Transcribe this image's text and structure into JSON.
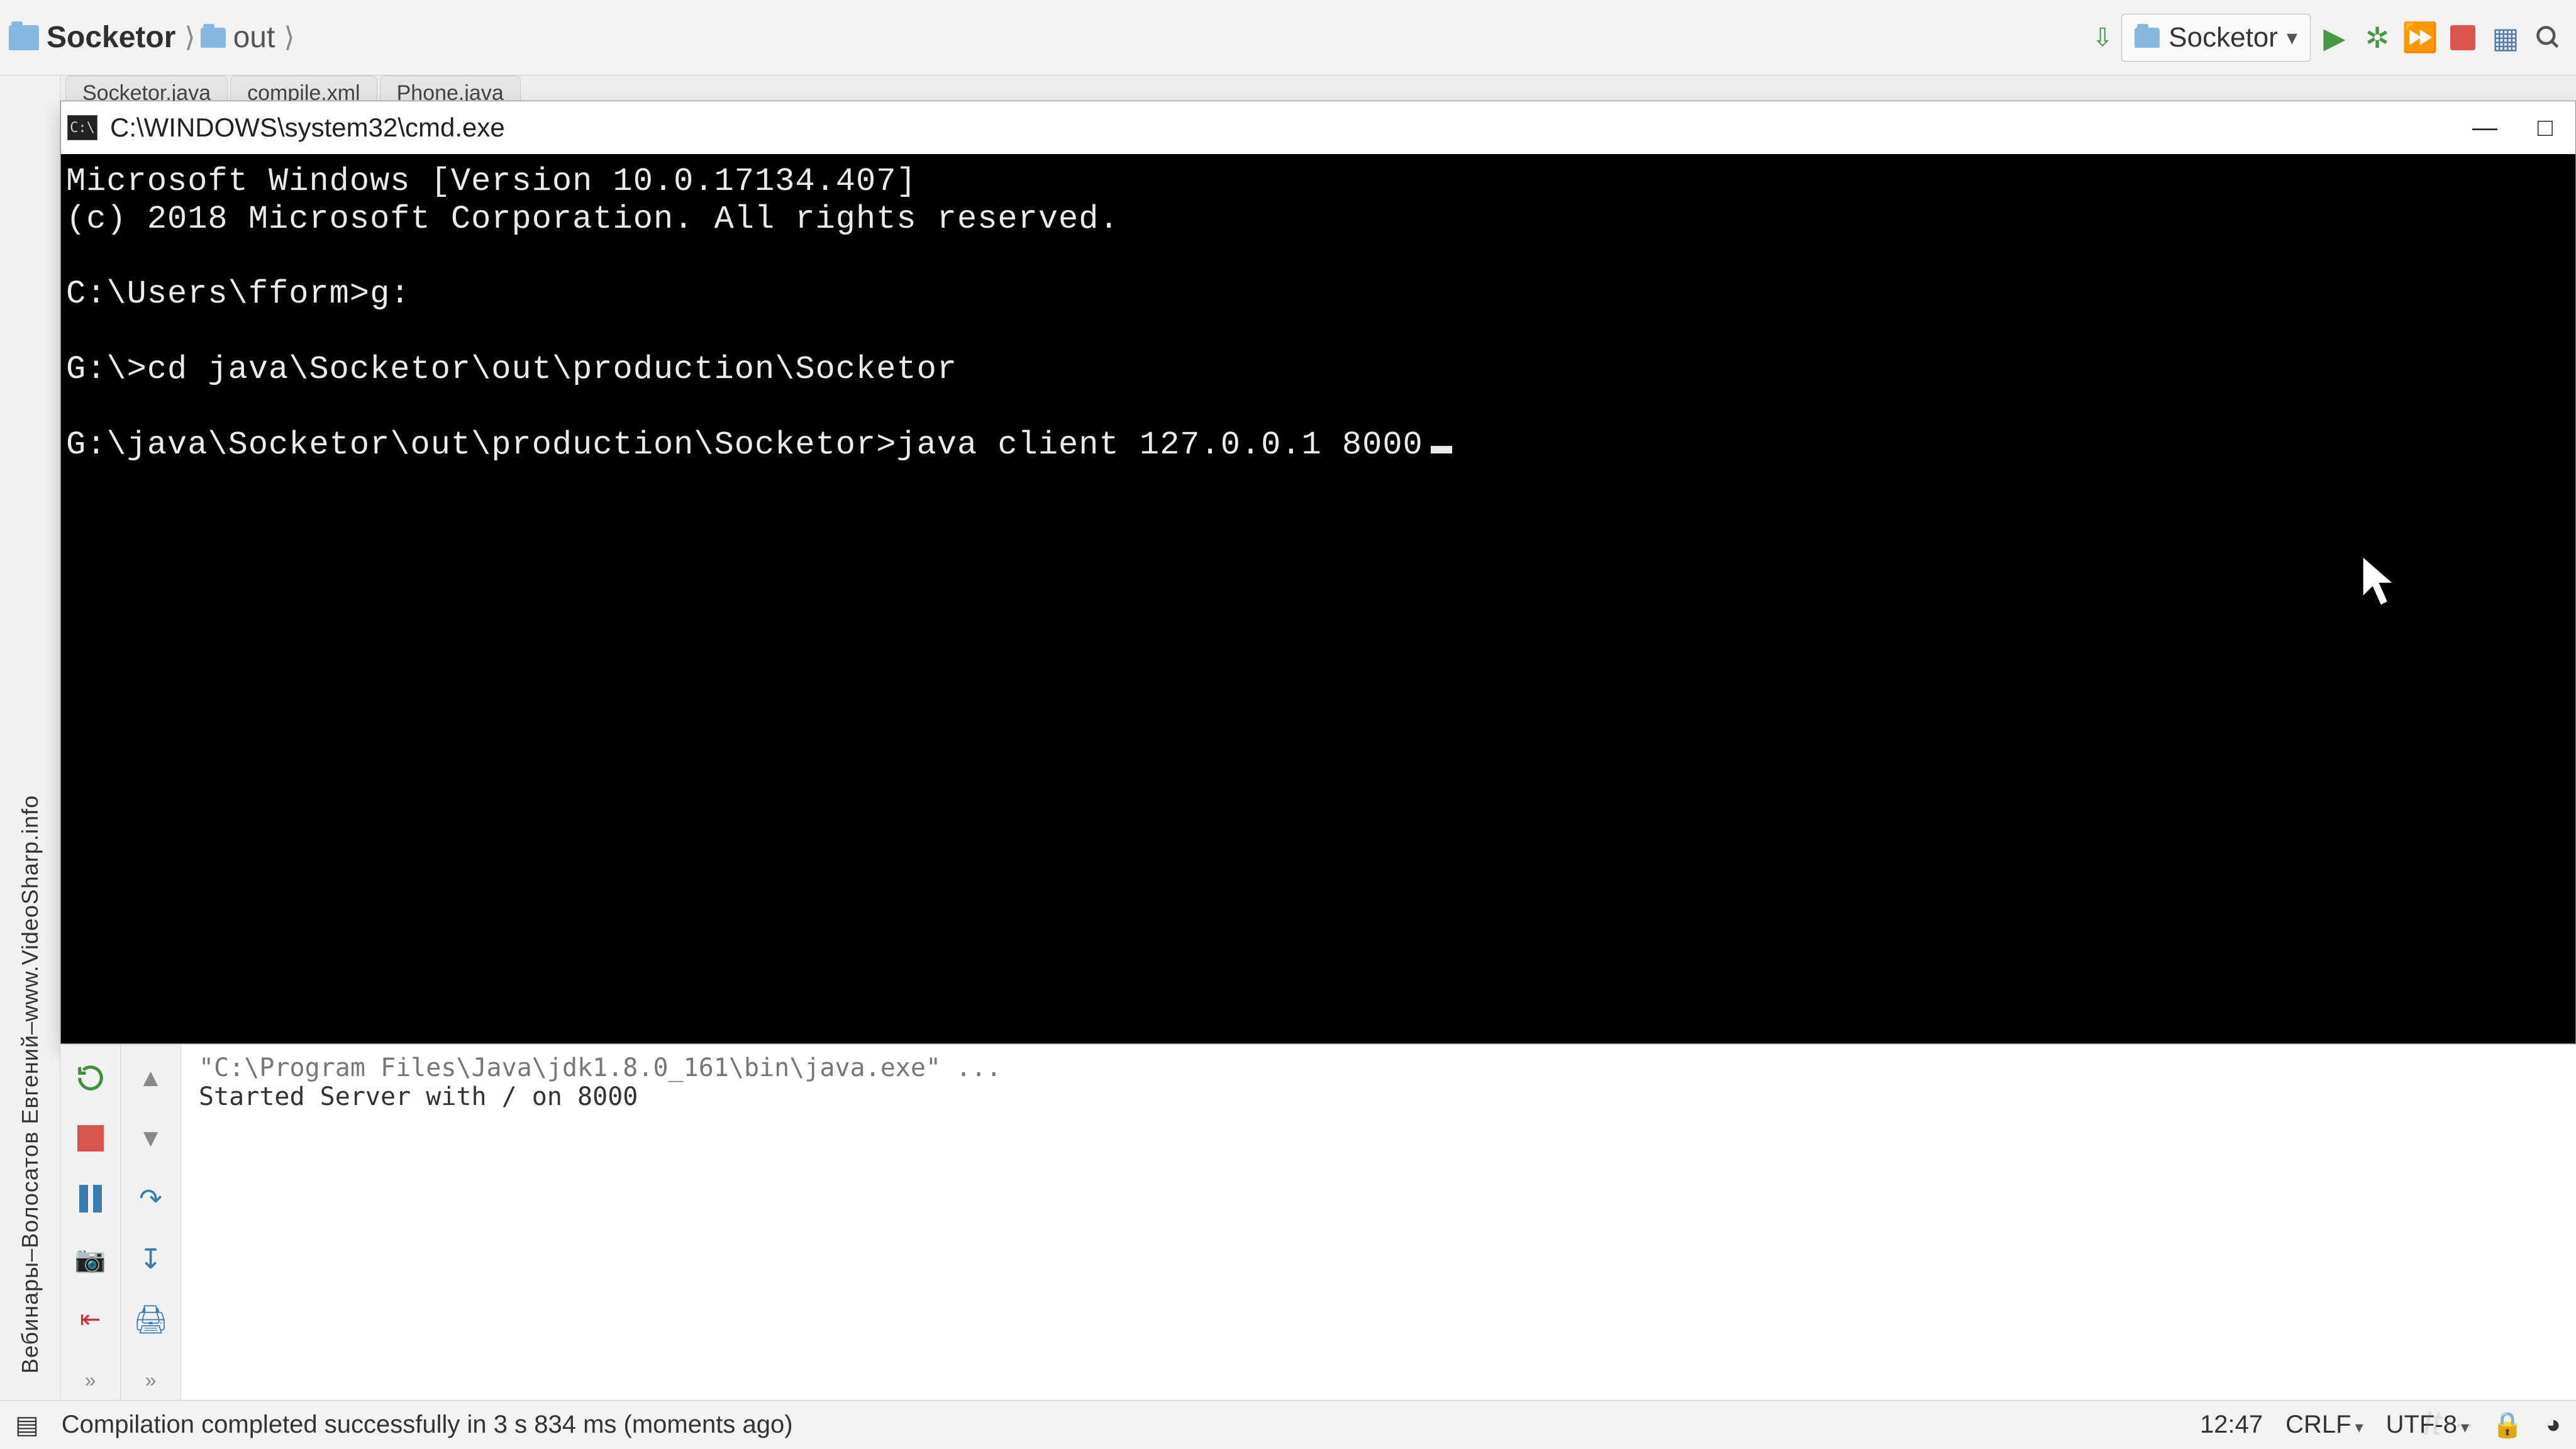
{
  "breadcrumb": {
    "project": "Socketor",
    "folder": "out"
  },
  "run_config": {
    "label": "Socketor"
  },
  "editor_tabs": [
    {
      "label": "Socketor.java"
    },
    {
      "label": "compile.xml"
    },
    {
      "label": "Phone.java"
    }
  ],
  "cmd": {
    "title": "C:\\WINDOWS\\system32\\cmd.exe",
    "lines": [
      "Microsoft Windows [Version 10.0.17134.407]",
      "(c) 2018 Microsoft Corporation. All rights reserved.",
      "",
      "C:\\Users\\fform>g:",
      "",
      "G:\\>cd java\\Socketor\\out\\production\\Socketor",
      "",
      "G:\\java\\Socketor\\out\\production\\Socketor>java client 127.0.0.1 8000"
    ]
  },
  "run_output": {
    "invoke": "\"C:\\Program Files\\Java\\jdk1.8.0_161\\bin\\java.exe\" ...",
    "line1": "Started Server with / on 8000"
  },
  "left_text": {
    "seg1": "www.VideoSharp.info",
    "dash1": "–",
    "seg2": "Волосатов Евгений",
    "dash2": "–",
    "seg3": "Вебинары"
  },
  "status": {
    "message": "Compilation completed successfully in 3 s 834 ms (moments ago)",
    "caret": "12:47",
    "le": "CRLF",
    "enc": "UTF-8"
  }
}
